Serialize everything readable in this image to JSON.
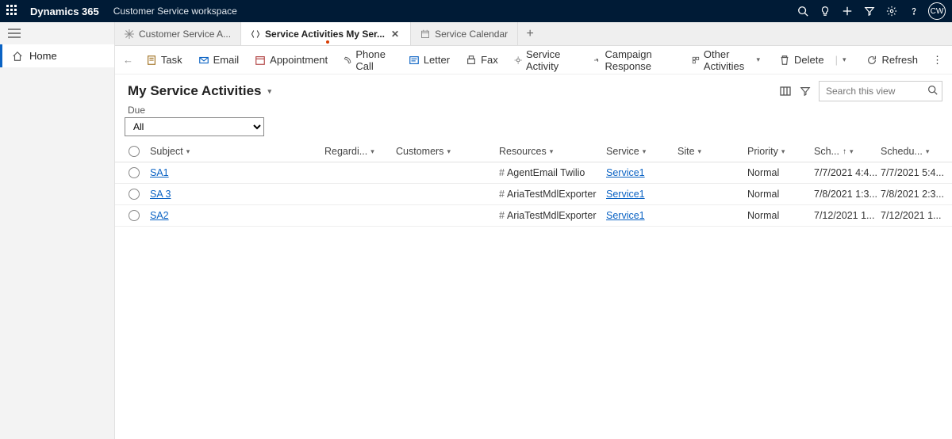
{
  "header": {
    "brand": "Dynamics 365",
    "workspace": "Customer Service workspace",
    "avatar": "CW"
  },
  "sidebar": {
    "items": [
      {
        "label": "Home"
      }
    ]
  },
  "tabs": [
    {
      "label": "Customer Service A...",
      "active": false,
      "closable": false
    },
    {
      "label": "Service Activities My Ser...",
      "active": true,
      "closable": true
    },
    {
      "label": "Service Calendar",
      "active": false,
      "closable": false
    }
  ],
  "commands": {
    "task": "Task",
    "email": "Email",
    "appointment": "Appointment",
    "phonecall": "Phone Call",
    "letter": "Letter",
    "fax": "Fax",
    "serviceactivity": "Service Activity",
    "campaign": "Campaign Response",
    "other": "Other Activities",
    "delete": "Delete",
    "refresh": "Refresh"
  },
  "view": {
    "title": "My Service Activities",
    "search_placeholder": "Search this view",
    "filter_label": "Due",
    "filter_value": "All"
  },
  "columns": {
    "subject": "Subject",
    "regarding": "Regardi...",
    "customers": "Customers",
    "resources": "Resources",
    "service": "Service",
    "site": "Site",
    "priority": "Priority",
    "scheduled_start": "Sch...",
    "scheduled_end": "Schedu..."
  },
  "rows": [
    {
      "subject": "SA1",
      "resource": "AgentEmail Twilio",
      "service": "Service1",
      "priority": "Normal",
      "sch_start": "7/7/2021 4:4...",
      "sch_end": "7/7/2021 5:4..."
    },
    {
      "subject": "SA 3",
      "resource": "AriaTestMdlExporter",
      "service": "Service1",
      "priority": "Normal",
      "sch_start": "7/8/2021 1:3...",
      "sch_end": "7/8/2021 2:3..."
    },
    {
      "subject": "SA2",
      "resource": "AriaTestMdlExporter",
      "service": "Service1",
      "priority": "Normal",
      "sch_start": "7/12/2021 1...",
      "sch_end": "7/12/2021 1..."
    }
  ]
}
